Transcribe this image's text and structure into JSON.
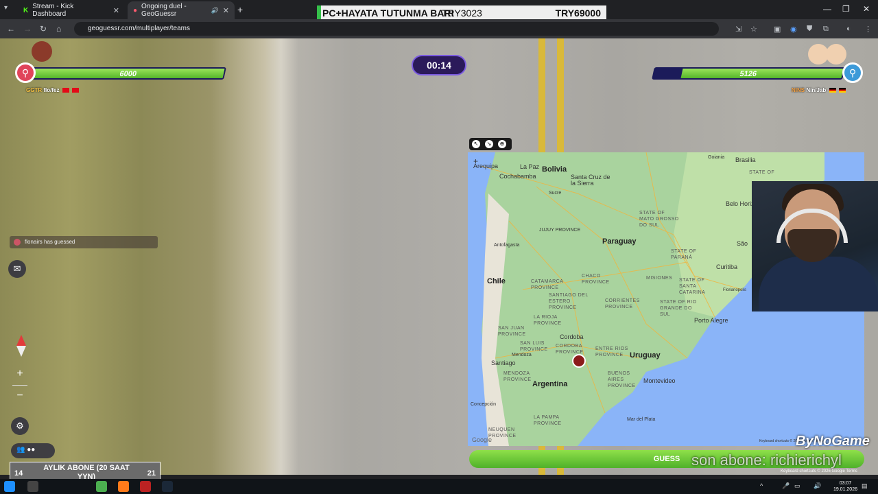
{
  "browser": {
    "tabs": [
      {
        "title": "Stream - Kick Dashboard",
        "active": false
      },
      {
        "title": "Ongoing duel - GeoGuessr",
        "active": true
      }
    ],
    "url": "geoguessr.com/multiplayer/teams"
  },
  "stream_overlay": {
    "left_text": "PC+HAYATA TUTUNMA BARI",
    "mid_text": "TRY3023",
    "right_text": "TRY69000"
  },
  "duel": {
    "timer": "00:14",
    "left_team": {
      "hp_label": "6000",
      "hp_fraction": 1.0,
      "tag": "GGTR",
      "names": "flo/fez"
    },
    "right_team": {
      "hp_label": "5126",
      "hp_fraction": 0.854,
      "tag": "NINS",
      "names": "Nin/Jab"
    },
    "guess_notice": "flonairs has guessed",
    "guess_button": "GUESS"
  },
  "map": {
    "countries": [
      "Bolivia",
      "Paraguay",
      "Chile",
      "Argentina",
      "Uruguay",
      "Brasilia"
    ],
    "cities": [
      "La Paz",
      "Cochabamba",
      "Santa Cruz de la Sierra",
      "Arequipa",
      "Sucre",
      "Antofagasta",
      "Curitiba",
      "Porto Alegre",
      "Cordoba",
      "Santiago",
      "Mendoza",
      "Montevideo",
      "Florianopolis",
      "Belo Horiz",
      "Concepción",
      "Mar del Plata",
      "Goiania",
      "São"
    ],
    "provinces": [
      "STATE OF MATO GROSSO DO SUL",
      "STATE OF PARANÁ",
      "STATE OF SANTA CATARINA",
      "STATE OF RIO GRANDE DO SUL",
      "CHACO PROVINCE",
      "CORRIENTES PROVINCE",
      "MISIONES",
      "SANTIAGO DEL ESTERO PROVINCE",
      "CATAMARCA PROVINCE",
      "LA RIOJA PROVINCE",
      "SAN JUAN PROVINCE",
      "SAN LUIS PROVINCE",
      "CORDOBA PROVINCE",
      "ENTRE RIOS PROVINCE",
      "BUENOS AIRES PROVINCE",
      "MENDOZA PROVINCE",
      "LA PAMPA PROVINCE",
      "NEUQUEN PROVINCE",
      "JUJUY PROVINCE",
      "STATE OF"
    ],
    "footer": "Keyboard shortcuts  © 2026 Google  Terms",
    "google": "Google"
  },
  "stream": {
    "brand": "ByNoGame",
    "last_sub": "son abone: richierichyl",
    "sub_goal": {
      "left": "14",
      "label": "AYLIK ABONE (20 SAAT YYN)",
      "right": "21"
    }
  },
  "taskbar": {
    "time": "03:07",
    "date": "19.01.2026"
  },
  "colors": {
    "hp_green": "#6cc83a",
    "team_left": "#e0445a",
    "team_right": "#3c9ad8",
    "timer_bg": "#2b1a5a"
  }
}
